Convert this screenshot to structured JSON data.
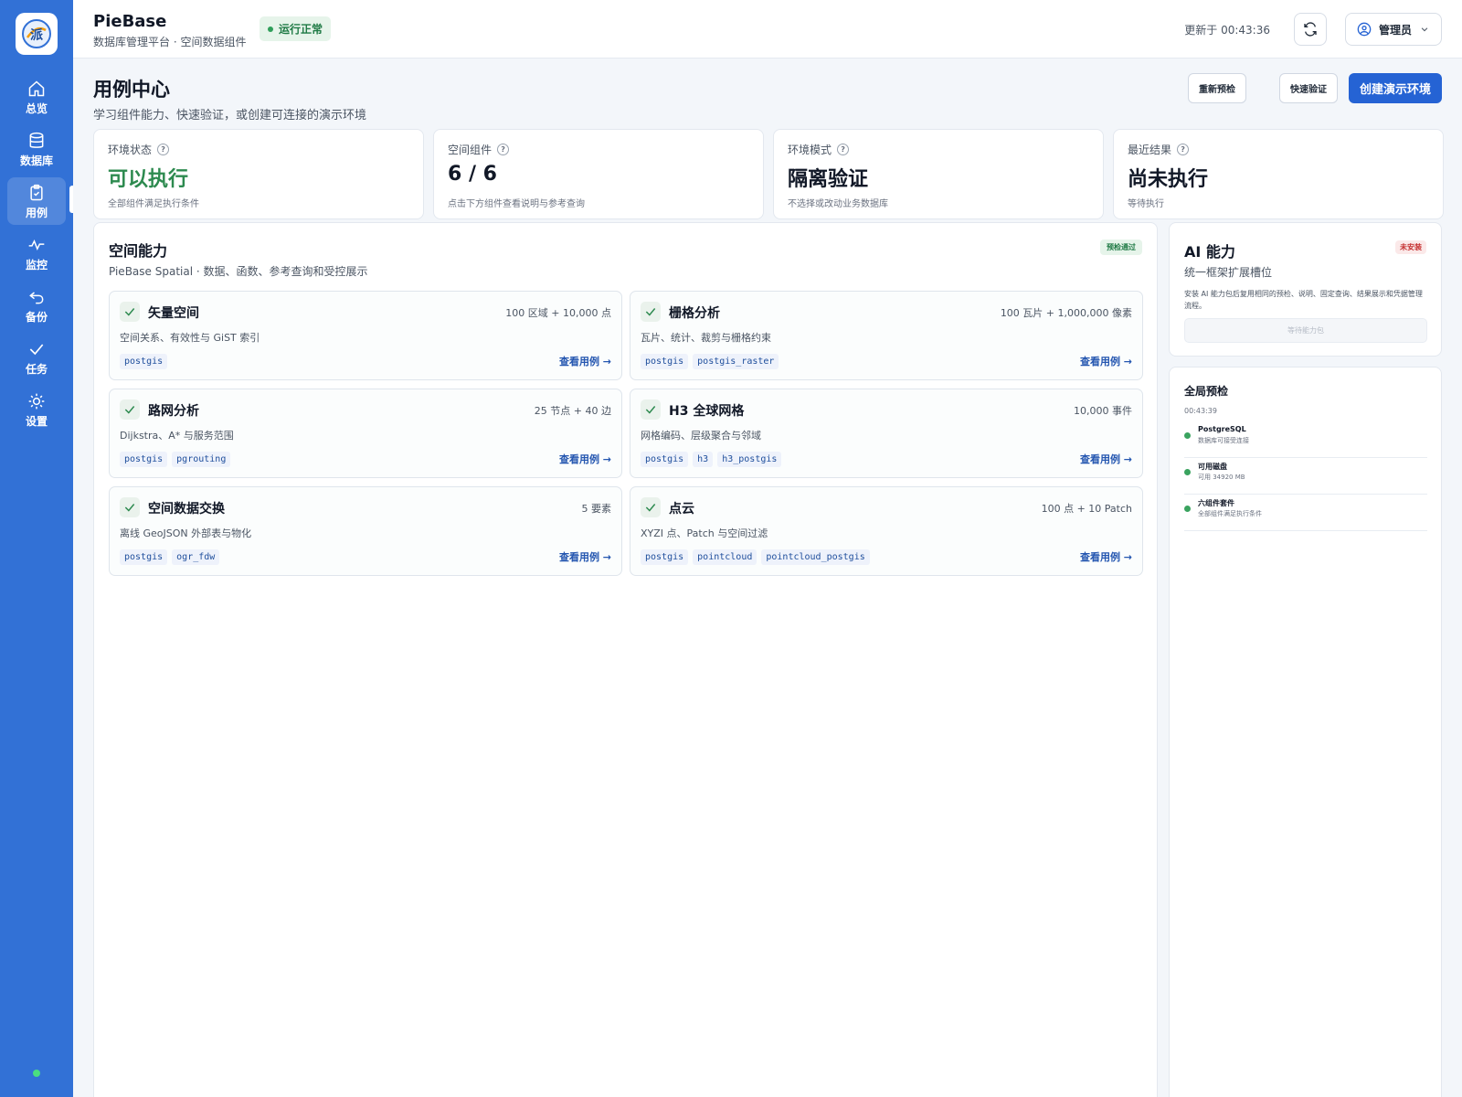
{
  "app": {
    "title": "PieBase",
    "subtitle": "数据库管理平台 · 空间数据组件",
    "health": "运行正常",
    "updated": "更新于 00:43:36",
    "user": "管理员"
  },
  "sidebar": {
    "items": [
      {
        "label": "总览",
        "icon": "home-icon"
      },
      {
        "label": "数据库",
        "icon": "database-icon"
      },
      {
        "label": "用例",
        "icon": "clipboard-check-icon",
        "active": true
      },
      {
        "label": "监控",
        "icon": "activity-icon"
      },
      {
        "label": "备份",
        "icon": "undo-icon"
      },
      {
        "label": "任务",
        "icon": "check-icon"
      },
      {
        "label": "设置",
        "icon": "sun-icon"
      }
    ]
  },
  "page": {
    "title": "用例中心",
    "description": "学习组件能力、快速验证，或创建可连接的演示环境",
    "buttons": {
      "recheck": "重新预检",
      "quick_verify": "快速验证",
      "create_demo": "创建演示环境"
    }
  },
  "stats": [
    {
      "label": "环境状态",
      "value": "可以执行",
      "hint": "全部组件满足执行条件"
    },
    {
      "label": "空间组件",
      "value": "6 / 6",
      "hint": "点击下方组件查看说明与参考查询"
    },
    {
      "label": "环境模式",
      "value": "隔离验证",
      "hint": "不选择或改动业务数据库"
    },
    {
      "label": "最近结果",
      "value": "尚未执行",
      "hint": "等待执行"
    }
  ],
  "spatial": {
    "title": "空间能力",
    "subtitle": "PieBase Spatial · 数据、函数、参考查询和受控展示",
    "badge": "预检通过",
    "link_label": "查看用例 →",
    "components": [
      {
        "name": "矢量空间",
        "count": "100 区域 + 10,000 点",
        "desc": "空间关系、有效性与 GiST 索引",
        "tags": [
          "postgis"
        ]
      },
      {
        "name": "栅格分析",
        "count": "100 瓦片 + 1,000,000 像素",
        "desc": "瓦片、统计、裁剪与栅格约束",
        "tags": [
          "postgis",
          "postgis_raster"
        ]
      },
      {
        "name": "路网分析",
        "count": "25 节点 + 40 边",
        "desc": "Dijkstra、A* 与服务范围",
        "tags": [
          "postgis",
          "pgrouting"
        ]
      },
      {
        "name": "H3 全球网格",
        "count": "10,000 事件",
        "desc": "网格编码、层级聚合与邻域",
        "tags": [
          "postgis",
          "h3",
          "h3_postgis"
        ]
      },
      {
        "name": "空间数据交换",
        "count": "5 要素",
        "desc": "离线 GeoJSON 外部表与物化",
        "tags": [
          "postgis",
          "ogr_fdw"
        ]
      },
      {
        "name": "点云",
        "count": "100 点 + 10 Patch",
        "desc": "XYZI 点、Patch 与空间过滤",
        "tags": [
          "postgis",
          "pointcloud",
          "pointcloud_postgis"
        ]
      }
    ]
  },
  "ai": {
    "title": "AI 能力",
    "badge": "未安装",
    "subtitle": "统一框架扩展槽位",
    "description": "安装 AI 能力包后复用相同的预检、说明、固定查询、结果展示和凭据管理流程。",
    "button": "等待能力包"
  },
  "precheck": {
    "title": "全局预检",
    "time": "00:43:39",
    "items": [
      {
        "name": "PostgreSQL",
        "detail": "数据库可接受连接"
      },
      {
        "name": "可用磁盘",
        "detail": "可用 34920 MB"
      },
      {
        "name": "六组件套件",
        "detail": "全部组件满足执行条件"
      }
    ]
  },
  "colors": {
    "sidebar": "#3271d6",
    "primary": "#2563d4",
    "success": "#2d8a4f",
    "danger": "#c53030"
  }
}
